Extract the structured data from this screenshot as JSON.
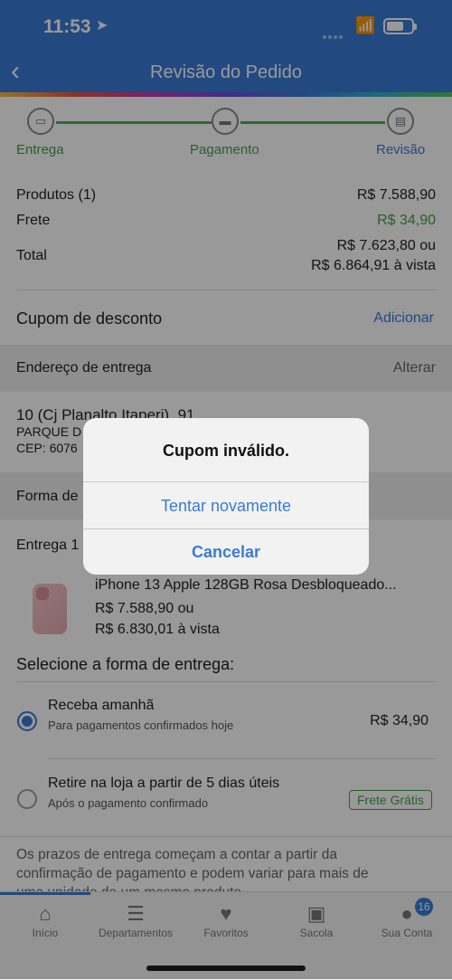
{
  "status": {
    "time": "11:53"
  },
  "navbar": {
    "back_glyph": "‹",
    "title": "Revisão do Pedido"
  },
  "steps": [
    {
      "label": "Entrega",
      "icon": "truck-icon"
    },
    {
      "label": "Pagamento",
      "icon": "card-icon"
    },
    {
      "label": "Revisão",
      "icon": "document-icon"
    }
  ],
  "summary": {
    "produtos_label": "Produtos (1)",
    "produtos_value": "R$ 7.588,90",
    "frete_label": "Frete",
    "frete_value": "R$ 34,90",
    "total_label": "Total",
    "total_value": "R$ 7.623,80 ou",
    "total_avista": "R$ 6.864,91 à vista"
  },
  "coupon": {
    "label": "Cupom de desconto",
    "action": "Adicionar"
  },
  "address": {
    "header": "Endereço de entrega",
    "action": "Alterar",
    "line1": "10 (Cj Planalto Itaperi), 91",
    "line2": "PARQUE D",
    "line3": "CEP: 6076"
  },
  "payment": {
    "header": "Forma de"
  },
  "delivery": {
    "label": "Entrega 1",
    "product_name": "iPhone 13 Apple 128GB Rosa Desbloqueado...",
    "product_price": "R$ 7.588,90 ou",
    "product_avista": "R$ 6.830,01 à vista",
    "select_title": "Selecione a forma de entrega:",
    "option1_title": "Receba amanhã",
    "option1_sub": "Para pagamentos confirmados hoje",
    "option1_price": "R$ 34,90",
    "option2_title": "Retire na loja a partir de 5 dias úteis",
    "option2_sub": "Após o pagamento confirmado",
    "option2_badge": "Frete Grátis",
    "note_line1": "Os prazos de entrega começam a contar a partir da",
    "note_line2": "confirmação de pagamento e podem variar para mais de",
    "note_line3": "uma unidade de um mesmo produto."
  },
  "tabbar": {
    "items": [
      {
        "label": "Início",
        "icon": "home-icon"
      },
      {
        "label": "Departamentos",
        "icon": "list-icon"
      },
      {
        "label": "Favoritos",
        "icon": "heart-icon"
      },
      {
        "label": "Sacola",
        "icon": "bag-icon"
      },
      {
        "label": "Sua Conta",
        "icon": "user-icon",
        "badge": "16"
      }
    ]
  },
  "alert": {
    "title": "Cupom inválido.",
    "retry": "Tentar novamente",
    "cancel": "Cancelar"
  },
  "colors": {
    "primary": "#3a7bd5",
    "green": "#43a047"
  }
}
